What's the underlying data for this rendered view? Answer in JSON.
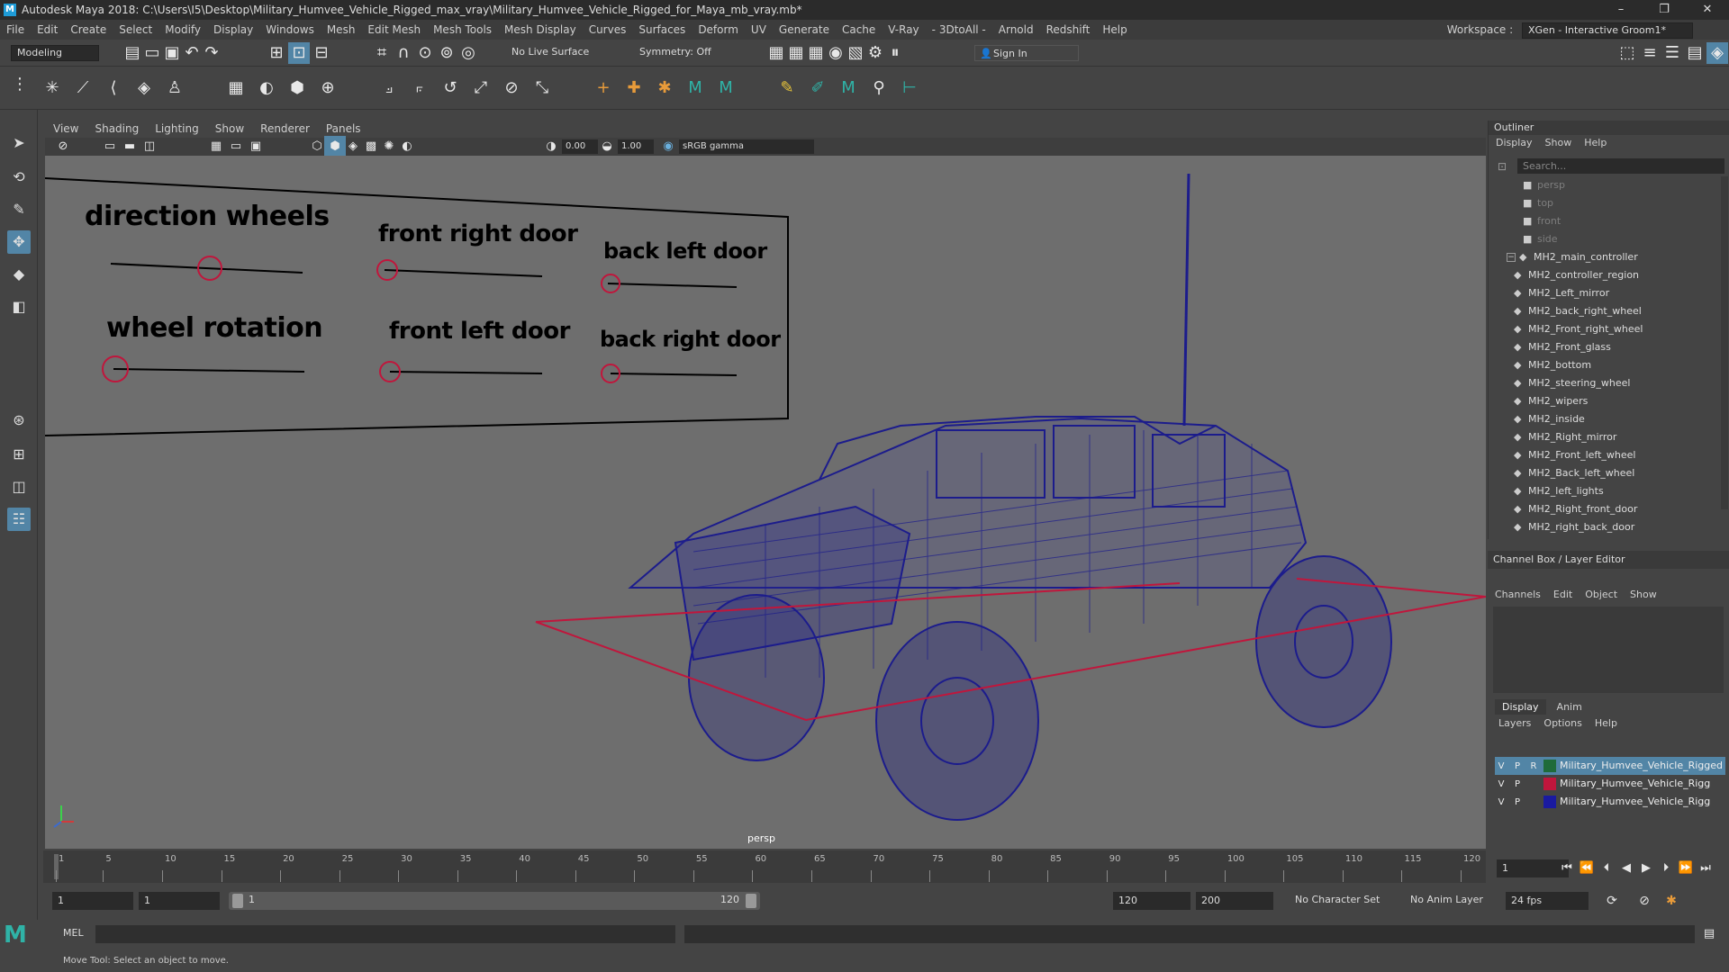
{
  "window": {
    "app_logo": "M",
    "title": "Autodesk Maya 2018: C:\\Users\\I5\\Desktop\\Military_Humvee_Vehicle_Rigged_max_vray\\Military_Humvee_Vehicle_Rigged_for_Maya_mb_vray.mb*",
    "minimize": "–",
    "maximize": "❐",
    "close": "✕"
  },
  "menubar": {
    "items": [
      "File",
      "Edit",
      "Create",
      "Select",
      "Modify",
      "Display",
      "Windows",
      "Mesh",
      "Edit Mesh",
      "Mesh Tools",
      "Mesh Display",
      "Curves",
      "Surfaces",
      "Deform",
      "UV",
      "Generate",
      "Cache",
      "V-Ray",
      "- 3DtoAll -",
      "Arnold",
      "Redshift",
      "Help"
    ],
    "workspace_label": "Workspace :",
    "workspace_value": "XGen - Interactive Groom1*"
  },
  "statusline": {
    "menuset": "Modeling",
    "live_surface": "No Live Surface",
    "symmetry": "Symmetry: Off",
    "sign_in": "Sign In"
  },
  "panel": {
    "menus": [
      "View",
      "Shading",
      "Lighting",
      "Show",
      "Renderer",
      "Panels"
    ],
    "exposure": "0.00",
    "gamma": "1.00",
    "colorspace": "sRGB gamma",
    "camera_label": "persp"
  },
  "controller_board": {
    "labels": [
      "direction wheels",
      "front right door",
      "back left door",
      "wheel rotation",
      "front left door",
      "back right door"
    ]
  },
  "outliner": {
    "title": "Outliner",
    "menus": [
      "Display",
      "Show",
      "Help"
    ],
    "search_placeholder": "Search...",
    "cameras": [
      "persp",
      "top",
      "front",
      "side"
    ],
    "root": "MH2_main_controller",
    "children": [
      "MH2_controller_region",
      "MH2_Left_mirror",
      "MH2_back_right_wheel",
      "MH2_Front_right_wheel",
      "MH2_Front_glass",
      "MH2_bottom",
      "MH2_steering_wheel",
      "MH2_wipers",
      "MH2_inside",
      "MH2_Right_mirror",
      "MH2_Front_left_wheel",
      "MH2_Back_left_wheel",
      "MH2_left_lights",
      "MH2_Right_front_door",
      "MH2_right_back_door"
    ]
  },
  "channelbox": {
    "title": "Channel Box / Layer Editor",
    "menus": [
      "Channels",
      "Edit",
      "Object",
      "Show"
    ]
  },
  "layers": {
    "tabs": [
      "Display",
      "Anim"
    ],
    "menus": [
      "Layers",
      "Options",
      "Help"
    ],
    "rows": [
      {
        "v": "V",
        "p": "P",
        "r": "R",
        "color": "#1f6b3a",
        "name": "Military_Humvee_Vehicle_Rigged"
      },
      {
        "v": "V",
        "p": "P",
        "r": "",
        "color": "#c0163c",
        "name": "Military_Humvee_Vehicle_Rigg"
      },
      {
        "v": "V",
        "p": "P",
        "r": "",
        "color": "#1a1aa0",
        "name": "Military_Humvee_Vehicle_Rigg"
      }
    ]
  },
  "timeline": {
    "ticks": [
      "1",
      "5",
      "10",
      "15",
      "20",
      "25",
      "30",
      "35",
      "40",
      "45",
      "50",
      "55",
      "60",
      "65",
      "70",
      "75",
      "80",
      "85",
      "90",
      "95",
      "100",
      "105",
      "110",
      "115",
      "120"
    ],
    "current_frame": "1"
  },
  "range": {
    "start": "1",
    "playback_start": "1",
    "slider_start": "1",
    "slider_end": "120",
    "playback_end": "120",
    "end": "200",
    "character_set": "No Character Set",
    "anim_layer": "No Anim Layer",
    "fps": "24 fps"
  },
  "cmdline": {
    "label": "MEL"
  },
  "helpline": {
    "text": "Move Tool: Select an object to move."
  },
  "colors": {
    "accent": "#5285a6",
    "wireframe": "#1c1c8c",
    "controller_red": "#c0163c"
  }
}
